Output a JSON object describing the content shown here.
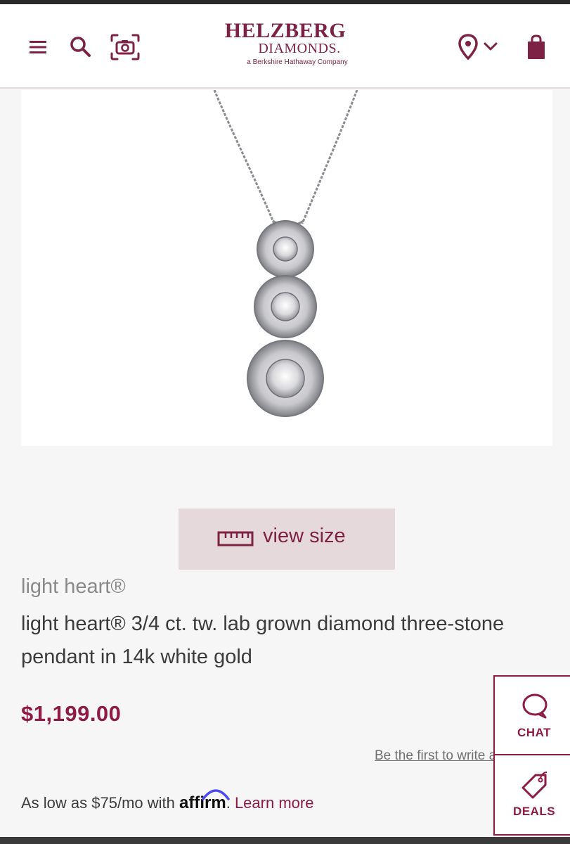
{
  "header": {
    "logo_main": "HELZBERG",
    "logo_sub": "DIAMONDS.",
    "logo_tagline": "a Berkshire Hathaway Company"
  },
  "product": {
    "view_size_label": "view size",
    "brand": "light heart®",
    "title": "light heart® 3/4 ct. tw. lab grown diamond three-stone pendant in 14k white gold",
    "price": "$1,199.00",
    "review_link": "Be the first to write a review"
  },
  "financing": {
    "prefix": "As low as $75/mo with",
    "provider": "affirm",
    "suffix": ".",
    "learn_more": "Learn more"
  },
  "side_widgets": {
    "chat_label": "CHAT",
    "deals_label": "DEALS"
  },
  "colors": {
    "brand": "#7d2245",
    "accent": "#8e1a45",
    "button_bg": "#e6d9dc"
  },
  "icons": [
    "menu-icon",
    "search-icon",
    "visual-search-icon",
    "location-icon",
    "chevron-down-icon",
    "shopping-bag-icon",
    "ruler-icon",
    "chat-bubble-icon",
    "tag-icon"
  ]
}
